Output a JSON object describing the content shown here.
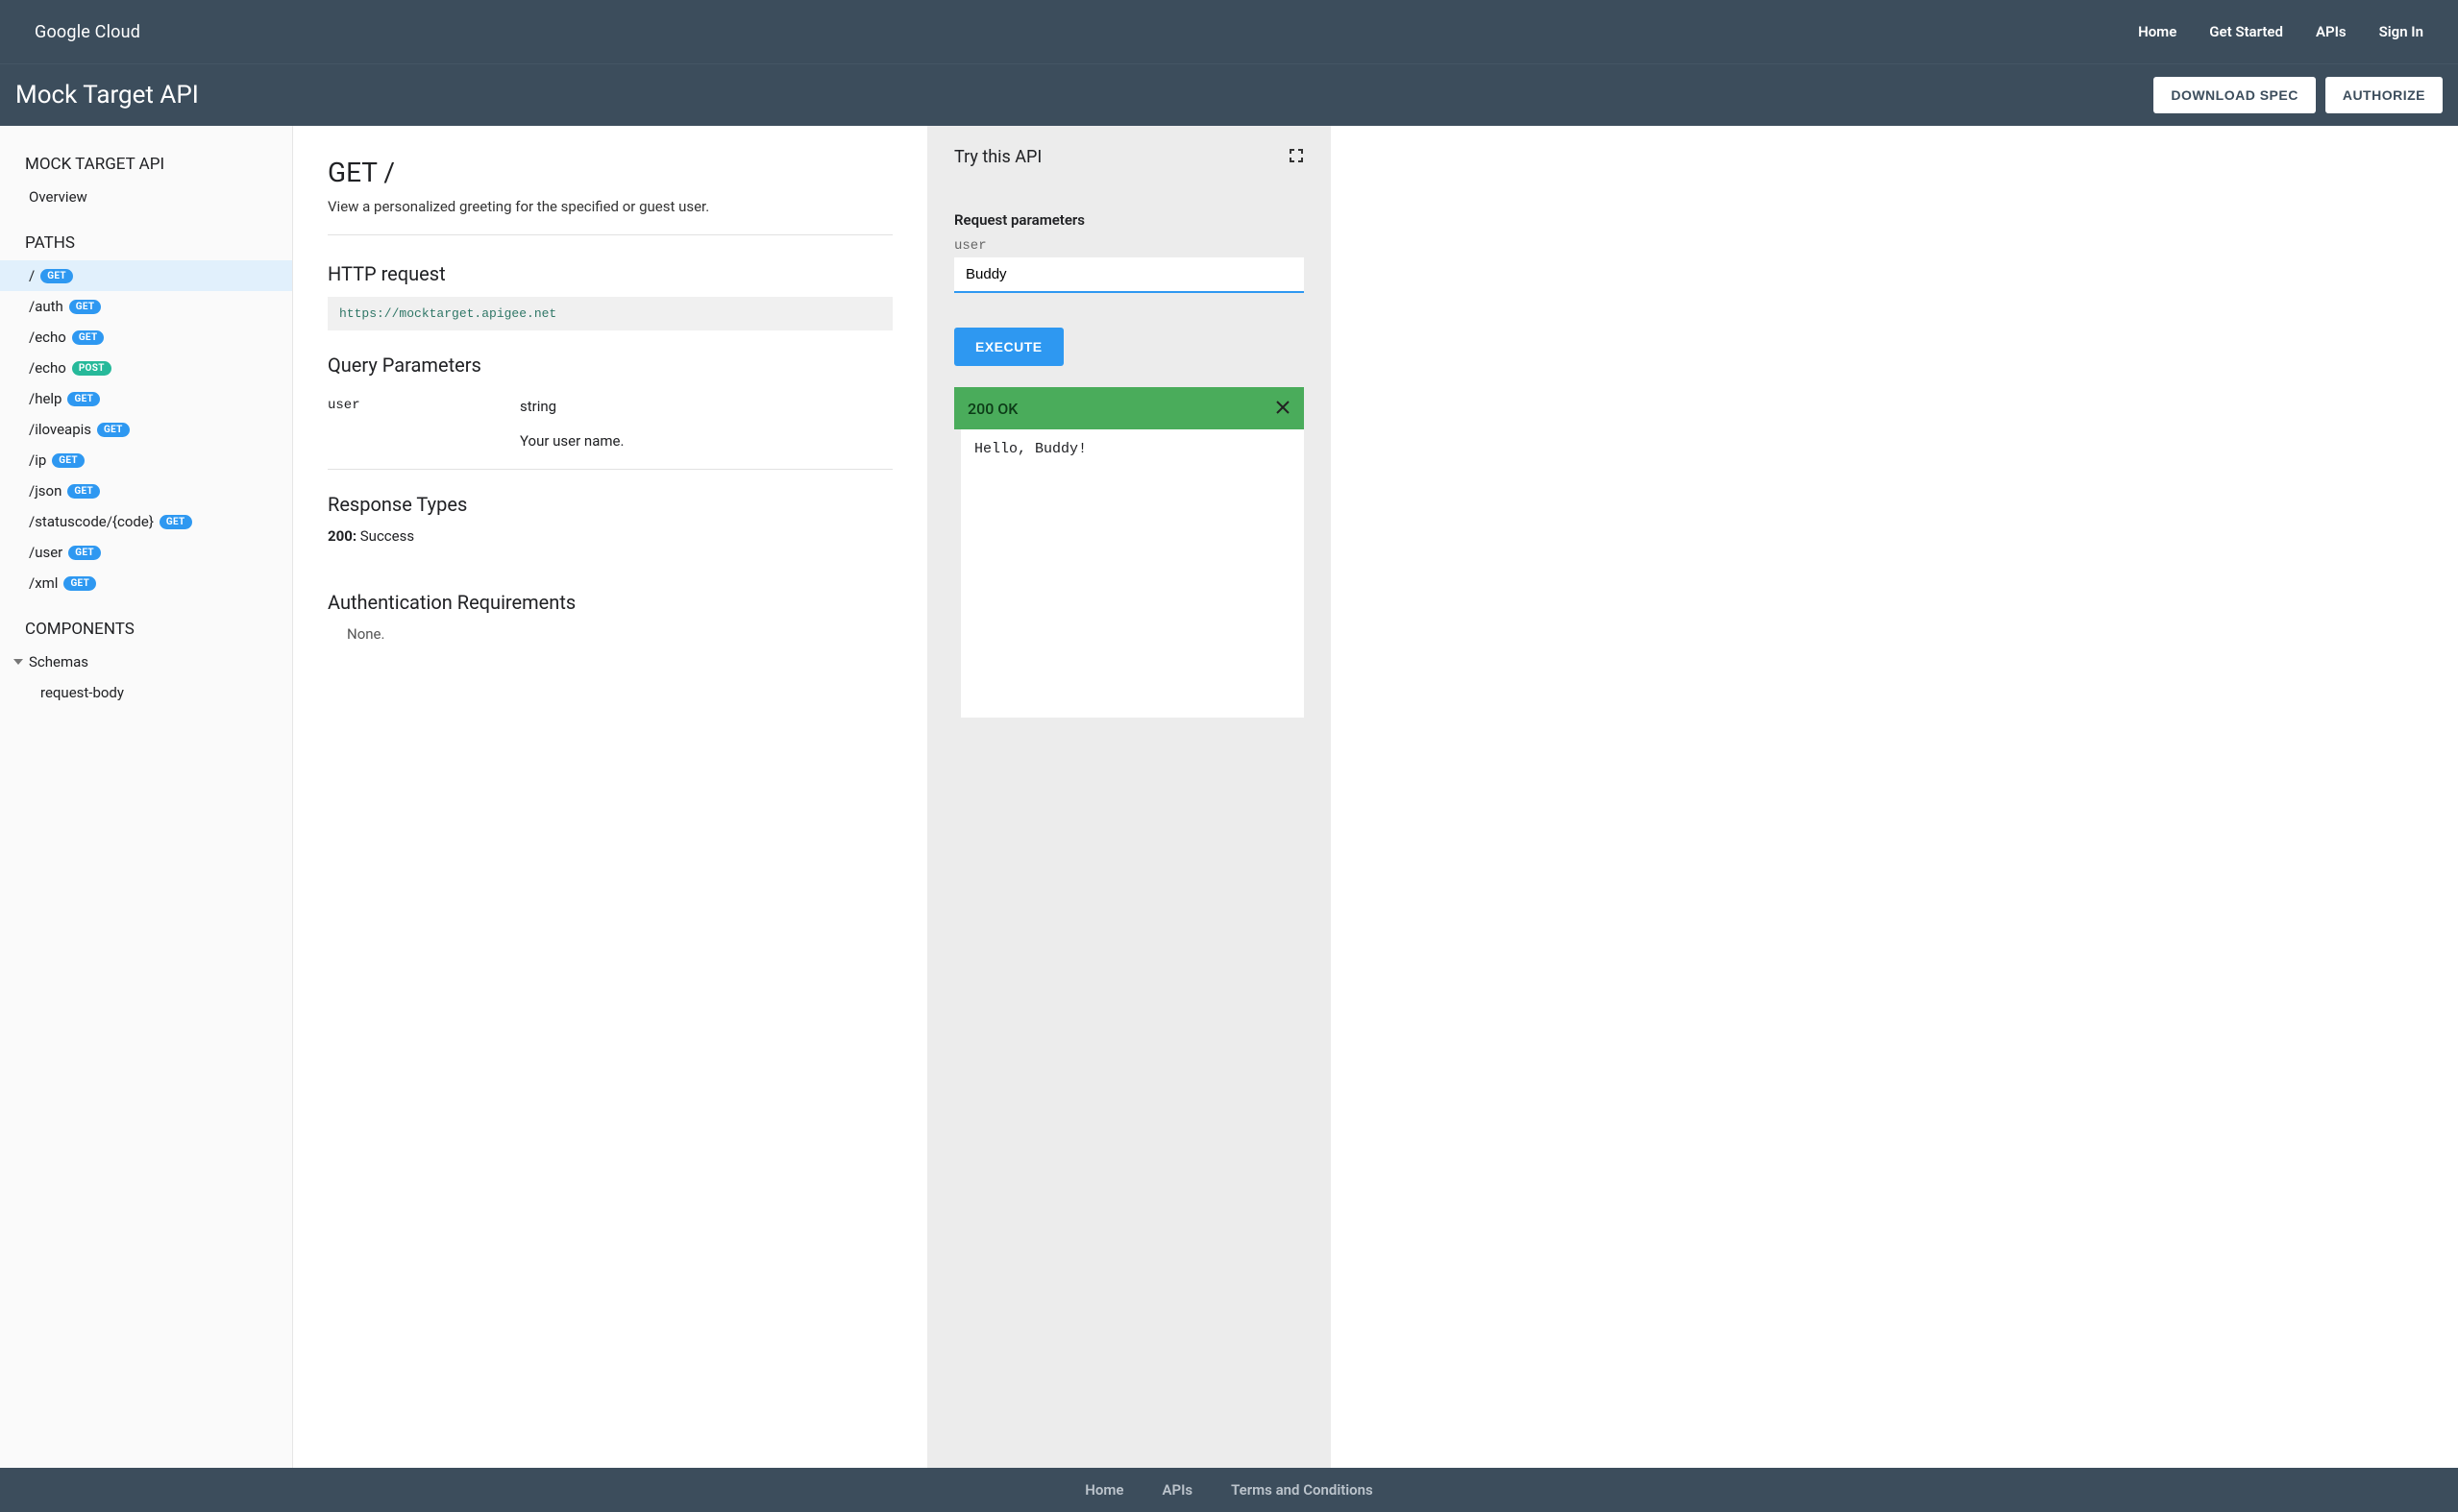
{
  "topnav": {
    "logo": "Google Cloud",
    "links": [
      "Home",
      "Get Started",
      "APIs",
      "Sign In"
    ]
  },
  "titlebar": {
    "title": "Mock Target API",
    "download": "DOWNLOAD SPEC",
    "authorize": "AUTHORIZE"
  },
  "sidebar": {
    "api_title": "MOCK TARGET API",
    "overview": "Overview",
    "paths_title": "PATHS",
    "paths": [
      {
        "path": "/",
        "method": "GET",
        "selected": true
      },
      {
        "path": "/auth",
        "method": "GET"
      },
      {
        "path": "/echo",
        "method": "GET"
      },
      {
        "path": "/echo",
        "method": "POST"
      },
      {
        "path": "/help",
        "method": "GET"
      },
      {
        "path": "/iloveapis",
        "method": "GET"
      },
      {
        "path": "/ip",
        "method": "GET"
      },
      {
        "path": "/json",
        "method": "GET"
      },
      {
        "path": "/statuscode/{code}",
        "method": "GET"
      },
      {
        "path": "/user",
        "method": "GET"
      },
      {
        "path": "/xml",
        "method": "GET"
      }
    ],
    "components_title": "COMPONENTS",
    "schemas_label": "Schemas",
    "schemas": [
      "request-body"
    ]
  },
  "content": {
    "heading": "GET /",
    "description": "View a personalized greeting for the specified or guest user.",
    "http_request_title": "HTTP request",
    "http_request_url": "https://mocktarget.apigee.net",
    "query_params_title": "Query Parameters",
    "params": [
      {
        "name": "user",
        "type": "string",
        "desc": "Your user name."
      }
    ],
    "response_types_title": "Response Types",
    "responses": [
      {
        "code": "200:",
        "text": " Success"
      }
    ],
    "auth_title": "Authentication Requirements",
    "auth_none": "None."
  },
  "trypanel": {
    "title": "Try this API",
    "req_params_title": "Request parameters",
    "field_label": "user",
    "field_value": "Buddy",
    "execute": "EXECUTE",
    "status": "200 OK",
    "response_body": "Hello, Buddy!"
  },
  "footer": {
    "links": [
      "Home",
      "APIs",
      "Terms and Conditions"
    ]
  }
}
